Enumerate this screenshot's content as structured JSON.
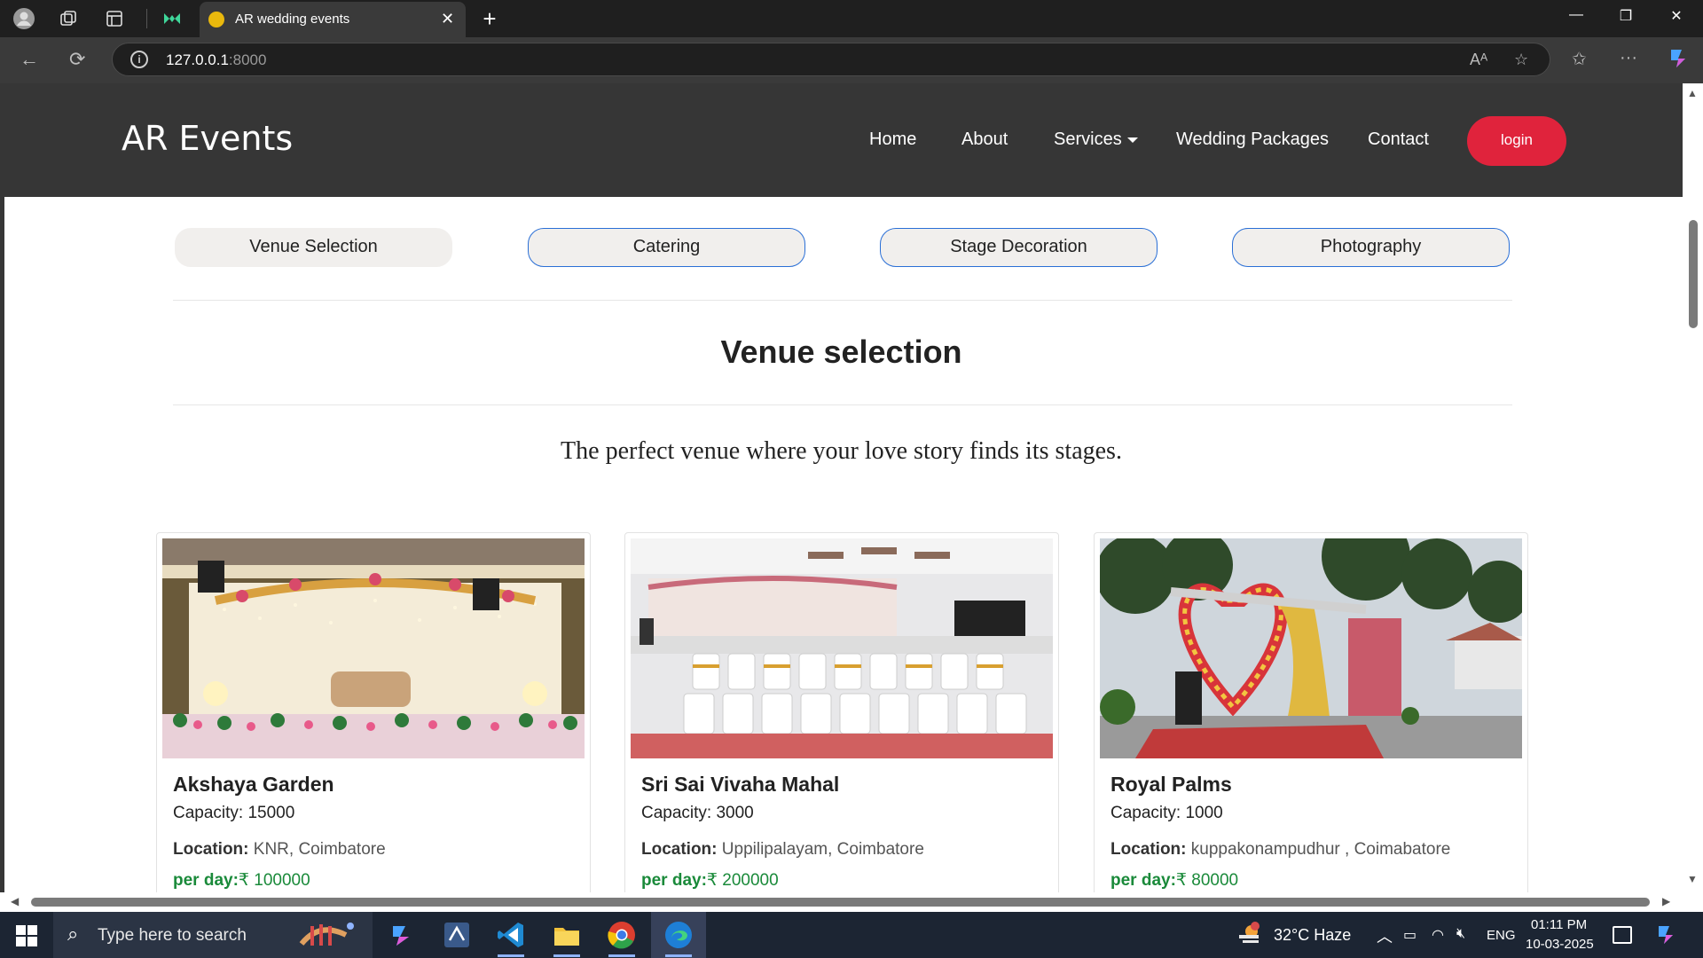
{
  "browser": {
    "tab_title": "AR wedding events",
    "url_host": "127.0.0.1",
    "url_port": ":8000"
  },
  "site": {
    "brand": "AR Events",
    "nav": [
      "Home",
      "About",
      "Services",
      "Wedding Packages",
      "Contact"
    ],
    "login_label": "login"
  },
  "service_tabs": [
    "Venue Selection",
    "Catering",
    "Stage Decoration",
    "Photography"
  ],
  "section": {
    "title": "Venue selection",
    "tagline": "The perfect venue where your love story finds its stages."
  },
  "venues": [
    {
      "name": "Akshaya Garden",
      "capacity": "Capacity: 15000",
      "location_label": "Location:",
      "location": " KNR, Coimbatore",
      "price_label": "per day:",
      "price": "₹ 100000"
    },
    {
      "name": "Sri Sai Vivaha Mahal",
      "capacity": "Capacity: 3000",
      "location_label": "Location:",
      "location": " Uppilipalayam, Coimbatore",
      "price_label": "per day:",
      "price": "₹ 200000"
    },
    {
      "name": "Royal Palms",
      "capacity": "Capacity: 1000",
      "location_label": "Location:",
      "location": " kuppakonampudhur , Coimabatore",
      "price_label": "per day:",
      "price": "₹ 80000"
    }
  ],
  "taskbar": {
    "search_placeholder": "Type here to search",
    "weather": "32°C  Haze",
    "language": "ENG",
    "time": "01:11 PM",
    "date": "10-03-2025"
  }
}
